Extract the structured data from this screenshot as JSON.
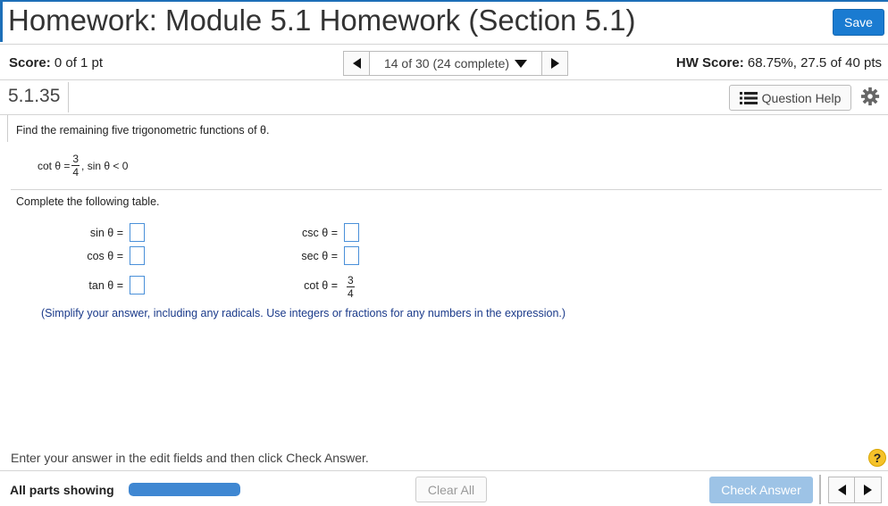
{
  "header": {
    "title": "Homework: Module 5.1 Homework (Section 5.1)",
    "save_label": "Save"
  },
  "status": {
    "score_label": "Score:",
    "score_value": "0 of 1 pt",
    "nav_text": "14 of 30 (24 complete)",
    "hw_score_label": "HW Score:",
    "hw_score_value": "68.75%, 27.5 of 40 pts"
  },
  "question": {
    "number": "5.1.35",
    "help_label": "Question Help",
    "instruction": "Find the remaining five trigonometric functions of θ.",
    "given_lhs": "cot θ =",
    "given_num": "3",
    "given_den": "4",
    "given_rhs": ", sin θ < 0",
    "table_instruction": "Complete the following table.",
    "rows": {
      "sin_label": "sin θ =",
      "cos_label": "cos θ =",
      "tan_label": "tan θ =",
      "csc_label": "csc θ =",
      "sec_label": "sec θ =",
      "cot_label": "cot θ =",
      "cot_num": "3",
      "cot_den": "4"
    },
    "hint": "(Simplify your answer, including any radicals.  Use integers or fractions for any numbers in the expression.)"
  },
  "footer": {
    "message": "Enter your answer in the edit fields and then click Check Answer.",
    "help_glyph": "?",
    "parts_label": "All parts showing",
    "progress_fraction": 1.0,
    "clear_label": "Clear All",
    "check_label": "Check Answer"
  },
  "colors": {
    "accent": "#1a7bd1",
    "progress": "#3f87d2",
    "input_border": "#4a90d9",
    "hint_text": "#1a3a8a",
    "help_badge": "#f5c22a"
  },
  "icons": {
    "prev": "triangle-left-icon",
    "next": "triangle-right-icon",
    "dropdown": "chevron-down-icon",
    "question_help": "list-icon",
    "settings": "gear-icon",
    "help": "help-icon"
  }
}
